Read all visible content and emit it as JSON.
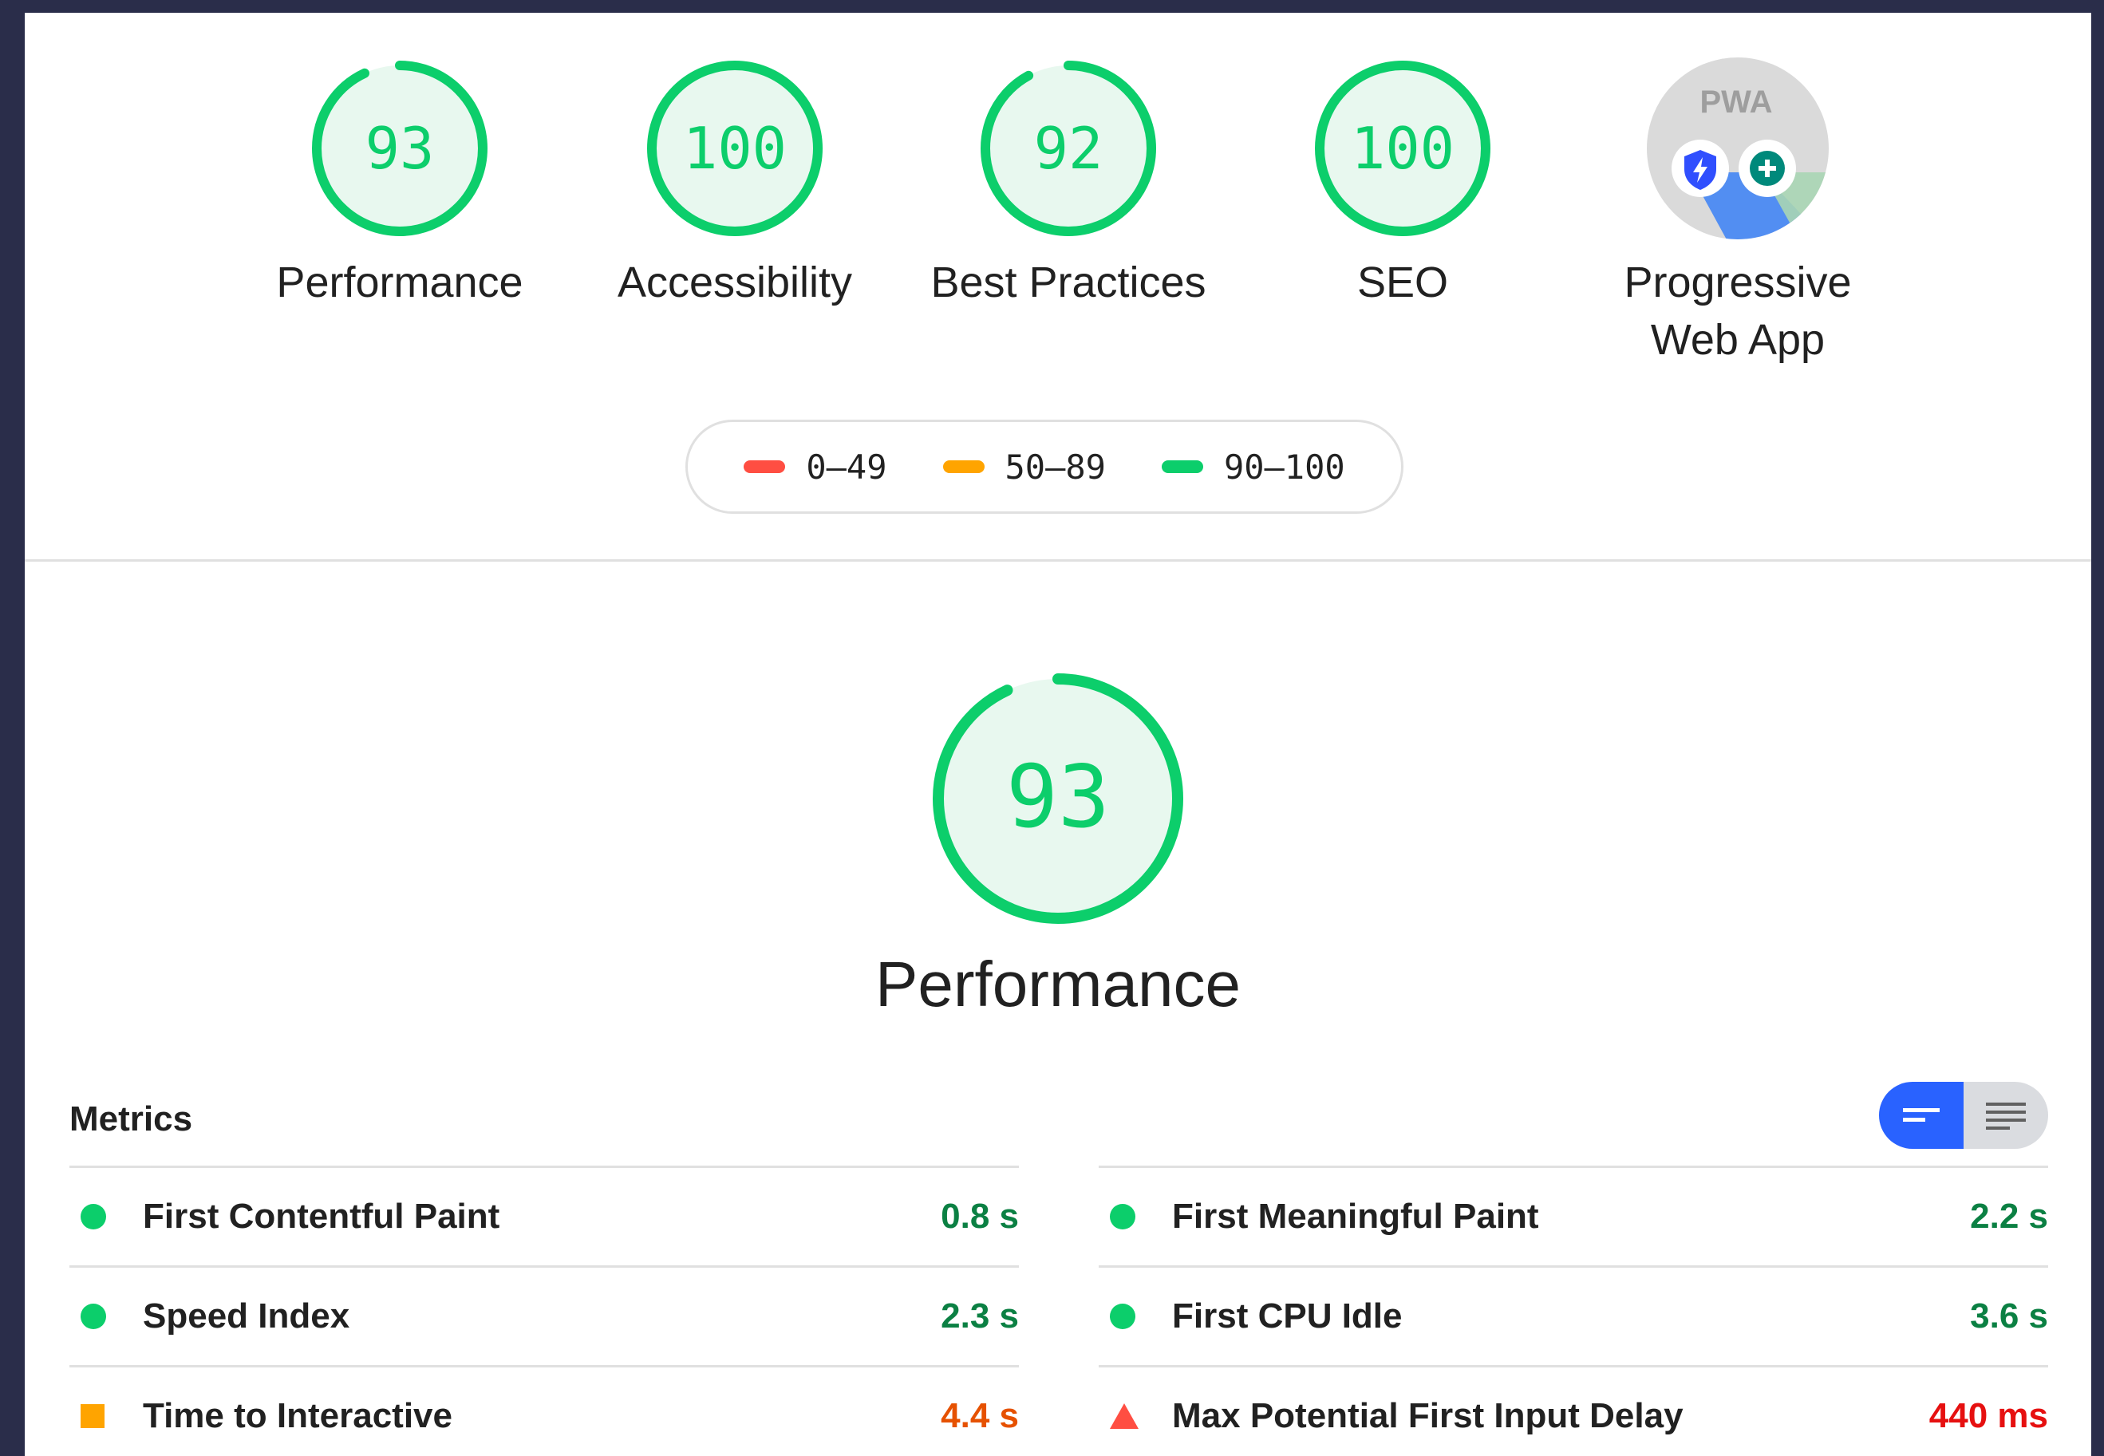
{
  "colors": {
    "pass": "#0cce6b",
    "average": "#ffa400",
    "fail": "#ff4e42",
    "pass_text": "#0b8043",
    "average_text": "#e65100",
    "fail_text": "#e61010",
    "toggle_active": "#2962ff"
  },
  "gauges": [
    {
      "score": "93",
      "label": "Performance",
      "fraction": 0.93
    },
    {
      "score": "100",
      "label": "Accessibility",
      "fraction": 1.0
    },
    {
      "score": "92",
      "label": "Best Practices",
      "fraction": 0.92
    },
    {
      "score": "100",
      "label": "SEO",
      "fraction": 1.0
    }
  ],
  "pwa": {
    "badge_text": "PWA",
    "label_line1": "Progressive",
    "label_line2": "Web App",
    "icons": [
      "shield-lightning-icon",
      "plus-circle-icon"
    ]
  },
  "legend": [
    {
      "range": "0–49",
      "color": "#ff4e42"
    },
    {
      "range": "50–89",
      "color": "#ffa400"
    },
    {
      "range": "90–100",
      "color": "#0cce6b"
    }
  ],
  "performance": {
    "score": "93",
    "fraction": 0.93,
    "title": "Performance"
  },
  "metrics": {
    "title": "Metrics",
    "toggle": {
      "active": "compact-view-icon",
      "inactive": "expanded-view-icon"
    },
    "left": [
      {
        "name": "First Contentful Paint",
        "value": "0.8 s",
        "status": "pass"
      },
      {
        "name": "Speed Index",
        "value": "2.3 s",
        "status": "pass"
      },
      {
        "name": "Time to Interactive",
        "value": "4.4 s",
        "status": "average"
      }
    ],
    "right": [
      {
        "name": "First Meaningful Paint",
        "value": "2.2 s",
        "status": "pass"
      },
      {
        "name": "First CPU Idle",
        "value": "3.6 s",
        "status": "pass"
      },
      {
        "name": "Max Potential First Input Delay",
        "value": "440 ms",
        "status": "fail"
      }
    ]
  }
}
